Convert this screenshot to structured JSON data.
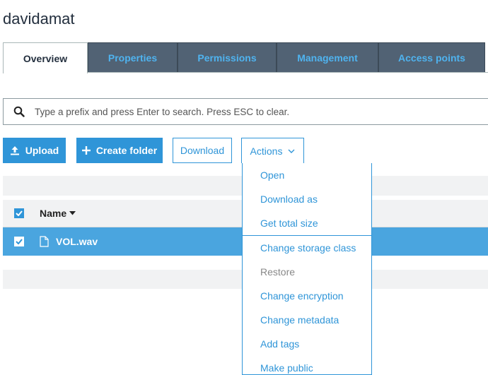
{
  "bucket": {
    "name": "davidamat"
  },
  "tabs": [
    {
      "label": "Overview",
      "active": true
    },
    {
      "label": "Properties",
      "active": false
    },
    {
      "label": "Permissions",
      "active": false
    },
    {
      "label": "Management",
      "active": false
    },
    {
      "label": "Access points",
      "active": false
    }
  ],
  "search": {
    "placeholder": "Type a prefix and press Enter to search. Press ESC to clear.",
    "value": "",
    "icon": "search-icon"
  },
  "toolbar": {
    "upload_label": "Upload",
    "create_folder_label": "Create folder",
    "download_label": "Download",
    "actions_label": "Actions"
  },
  "table": {
    "header_name": "Name",
    "header_checked": true,
    "rows": [
      {
        "name": "VOL.wav",
        "checked": true,
        "selected": true,
        "icon": "file-icon"
      }
    ]
  },
  "actions_menu": {
    "items": [
      {
        "label": "Open",
        "enabled": true
      },
      {
        "label": "Download as",
        "enabled": true
      },
      {
        "label": "Get total size",
        "enabled": true
      },
      {
        "label": "Change storage class",
        "enabled": true
      },
      {
        "label": "Restore",
        "enabled": false
      },
      {
        "label": "Change encryption",
        "enabled": true
      },
      {
        "label": "Change metadata",
        "enabled": true
      },
      {
        "label": "Add tags",
        "enabled": true
      },
      {
        "label": "Make public",
        "enabled": true
      }
    ]
  },
  "colors": {
    "accent": "#2f95d8",
    "selected_row": "#4aa5df",
    "tab_bg": "#516274",
    "tab_text": "#4fb3ef"
  }
}
